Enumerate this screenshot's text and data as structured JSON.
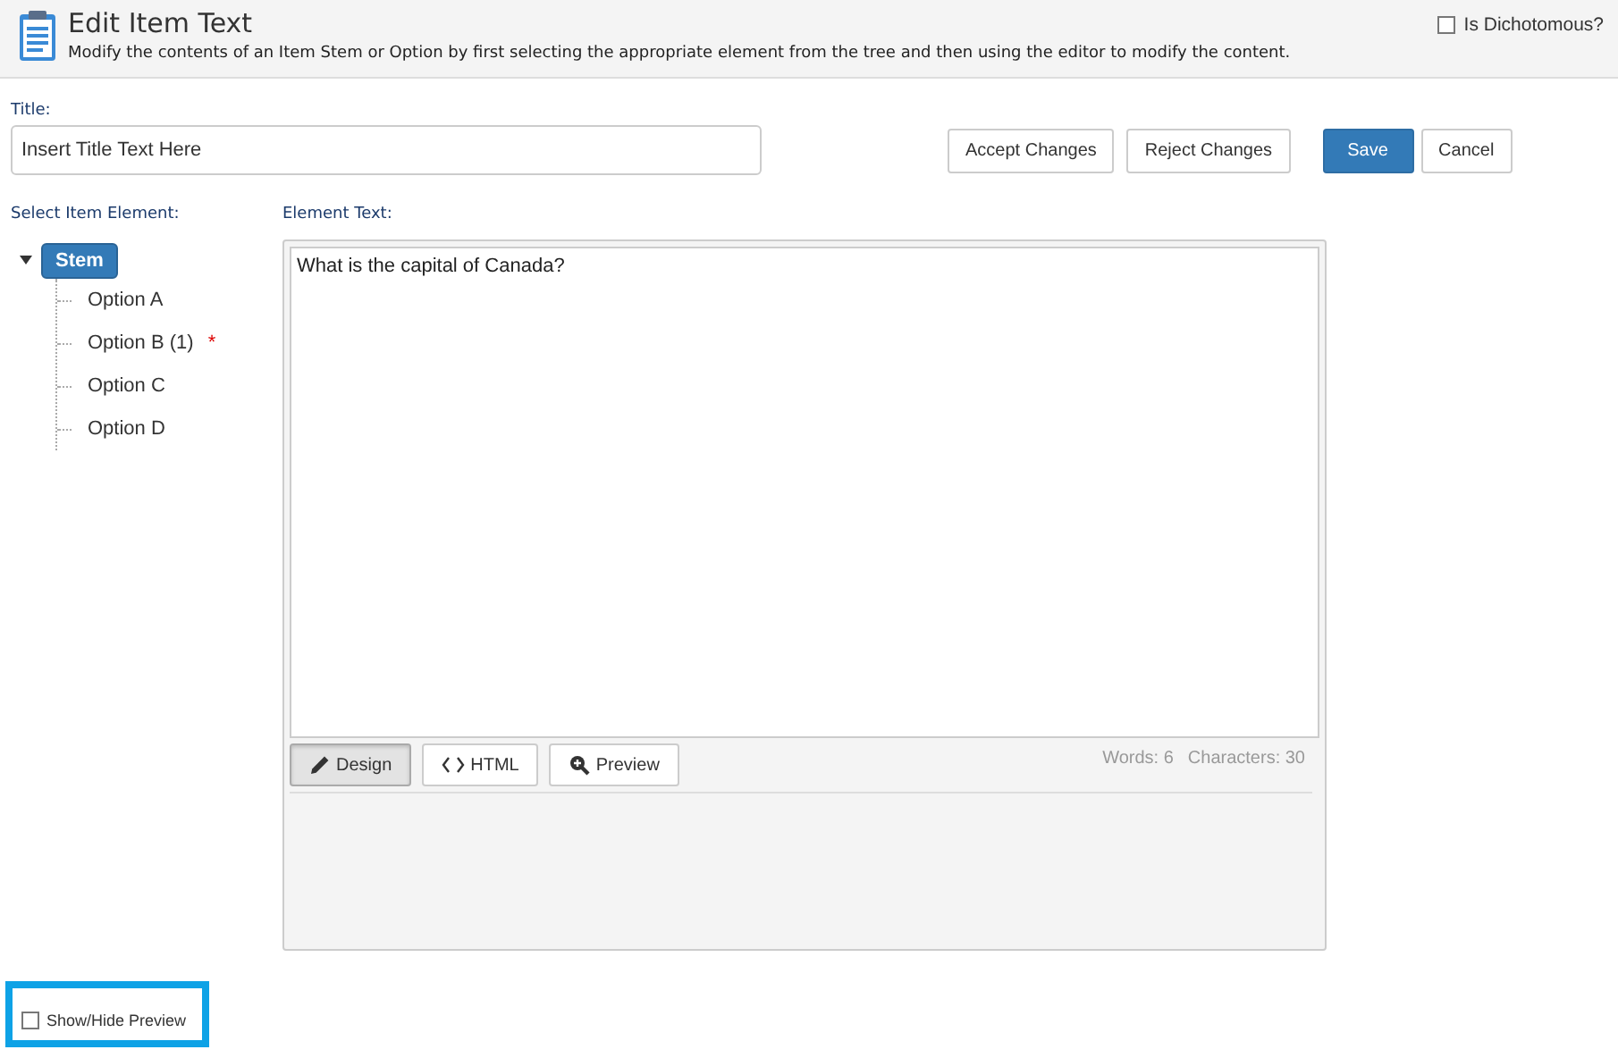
{
  "header": {
    "title": "Edit Item Text",
    "description": "Modify the contents of an Item Stem or Option by first selecting the appropriate element from the tree and then using the editor to modify the content.",
    "dichotomous": {
      "label": "Is Dichotomous?",
      "checked": false
    }
  },
  "title_field": {
    "label": "Title:",
    "value": "Insert Title Text Here"
  },
  "buttons": [
    {
      "label": "Accept Changes",
      "kind": "default"
    },
    {
      "label": "Reject Changes",
      "kind": "default"
    },
    {
      "label": "Save",
      "kind": "primary"
    },
    {
      "label": "Cancel",
      "kind": "default"
    }
  ],
  "tree": {
    "label": "Select Item Element:",
    "root": {
      "label": "Stem",
      "selected": true,
      "expanded": true,
      "children": [
        {
          "label": "Option A",
          "selected": false
        },
        {
          "label": "Option B (1)",
          "selected": false,
          "marker": "*"
        },
        {
          "label": "Option C",
          "selected": false
        },
        {
          "label": "Option D",
          "selected": false
        }
      ]
    }
  },
  "editor": {
    "label": "Element Text:",
    "content": "What is the capital of Canada?",
    "modes": [
      {
        "label": "Design",
        "kind": "design",
        "selected": true
      },
      {
        "label": "HTML",
        "kind": "source",
        "selected": false
      },
      {
        "label": "Preview",
        "kind": "preview",
        "selected": false
      }
    ],
    "words": "Words: 6",
    "characters": "Characters: 30"
  },
  "preview_toggle": {
    "label": "Show/Hide Preview",
    "checked": false,
    "highlighted": true
  }
}
